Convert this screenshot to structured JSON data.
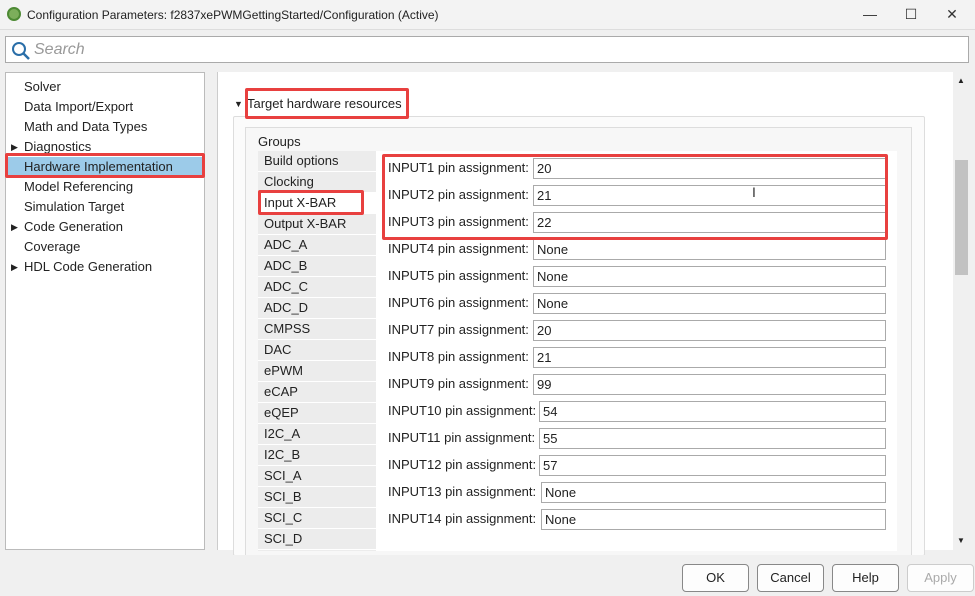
{
  "window": {
    "title": "Configuration Parameters: f2837xePWMGettingStarted/Configuration (Active)",
    "minimize": "—",
    "maximize": "☐",
    "close": "✕"
  },
  "search": {
    "placeholder": "Search"
  },
  "tree": [
    {
      "label": "Solver"
    },
    {
      "label": "Data Import/Export"
    },
    {
      "label": "Math and Data Types"
    },
    {
      "label": "Diagnostics",
      "expandable": true
    },
    {
      "label": "Hardware Implementation",
      "selected": true
    },
    {
      "label": "Model Referencing"
    },
    {
      "label": "Simulation Target"
    },
    {
      "label": "Code Generation",
      "expandable": true
    },
    {
      "label": "Coverage"
    },
    {
      "label": "HDL Code Generation",
      "expandable": true
    }
  ],
  "section": {
    "title": "Target hardware resources",
    "groups_label": "Groups"
  },
  "groups": [
    "Build options",
    "Clocking",
    "Input X-BAR",
    "Output X-BAR",
    "ADC_A",
    "ADC_B",
    "ADC_C",
    "ADC_D",
    "CMPSS",
    "DAC",
    "ePWM",
    "eCAP",
    "eQEP",
    "I2C_A",
    "I2C_B",
    "SCI_A",
    "SCI_B",
    "SCI_C",
    "SCI_D"
  ],
  "selected_group": "Input X-BAR",
  "fields": [
    {
      "label": "INPUT1 pin assignment:",
      "value": "20"
    },
    {
      "label": "INPUT2 pin assignment:",
      "value": "21"
    },
    {
      "label": "INPUT3 pin assignment:",
      "value": "22"
    },
    {
      "label": "INPUT4 pin assignment:",
      "value": "None"
    },
    {
      "label": "INPUT5 pin assignment:",
      "value": "None"
    },
    {
      "label": "INPUT6 pin assignment:",
      "value": "None"
    },
    {
      "label": "INPUT7 pin assignment:",
      "value": "20"
    },
    {
      "label": "INPUT8 pin assignment:",
      "value": "21"
    },
    {
      "label": "INPUT9 pin assignment:",
      "value": "99"
    },
    {
      "label": "INPUT10 pin assignment:",
      "value": "54"
    },
    {
      "label": "INPUT11 pin assignment:",
      "value": "55"
    },
    {
      "label": "INPUT12 pin assignment:",
      "value": "57"
    },
    {
      "label": "INPUT13 pin assignment:",
      "value": "None"
    },
    {
      "label": "INPUT14 pin assignment:",
      "value": "None"
    }
  ],
  "buttons": {
    "ok": "OK",
    "cancel": "Cancel",
    "help": "Help",
    "apply": "Apply"
  },
  "colors": {
    "highlight": "#e8403f",
    "selection": "#9ccbe9"
  }
}
